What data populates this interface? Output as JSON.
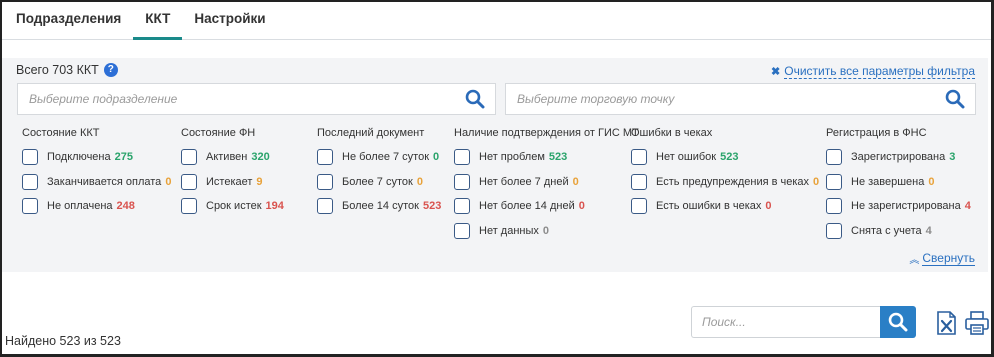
{
  "tabs": [
    {
      "label": "Подразделения",
      "active": false
    },
    {
      "label": "ККТ",
      "active": true
    },
    {
      "label": "Настройки",
      "active": false
    }
  ],
  "filter": {
    "total_label": "Всего 703 ККТ",
    "clear_label": "Очистить все параметры фильтра",
    "division_placeholder": "Выберите подразделение",
    "outlet_placeholder": "Выберите торговую точку",
    "collapse_label": "Свернуть"
  },
  "groups": [
    {
      "title": "Состояние ККТ",
      "options": [
        {
          "label": "Подключена",
          "count": "275",
          "tone": "green"
        },
        {
          "label": "Заканчивается оплата",
          "count": "0",
          "tone": "orange"
        },
        {
          "label": "Не оплачена",
          "count": "248",
          "tone": "red"
        }
      ]
    },
    {
      "title": "Состояние ФН",
      "options": [
        {
          "label": "Активен",
          "count": "320",
          "tone": "green"
        },
        {
          "label": "Истекает",
          "count": "9",
          "tone": "orange"
        },
        {
          "label": "Срок истек",
          "count": "194",
          "tone": "red"
        }
      ]
    },
    {
      "title": "Последний документ",
      "options": [
        {
          "label": "Не более 7 суток",
          "count": "0",
          "tone": "green"
        },
        {
          "label": "Более 7 суток",
          "count": "0",
          "tone": "orange"
        },
        {
          "label": "Более 14 суток",
          "count": "523",
          "tone": "red"
        }
      ]
    },
    {
      "title": "Наличие подтверждения от ГИС МТ",
      "options": [
        {
          "label": "Нет проблем",
          "count": "523",
          "tone": "green"
        },
        {
          "label": "Нет более 7 дней",
          "count": "0",
          "tone": "orange"
        },
        {
          "label": "Нет более 14 дней",
          "count": "0",
          "tone": "red"
        },
        {
          "label": "Нет данных",
          "count": "0",
          "tone": "gray"
        }
      ]
    },
    {
      "title": "Ошибки в чеках",
      "options": [
        {
          "label": "Нет ошибок",
          "count": "523",
          "tone": "green"
        },
        {
          "label": "Есть предупреждения в чеках",
          "count": "0",
          "tone": "orange"
        },
        {
          "label": "Есть ошибки в чеках",
          "count": "0",
          "tone": "red"
        }
      ]
    },
    {
      "title": "Регистрация в ФНС",
      "options": [
        {
          "label": "Зарегистрирована",
          "count": "3",
          "tone": "green"
        },
        {
          "label": "Не завершена",
          "count": "0",
          "tone": "orange"
        },
        {
          "label": "Не зарегистрирована",
          "count": "4",
          "tone": "red"
        },
        {
          "label": "Снята с учета",
          "count": "4",
          "tone": "gray"
        }
      ]
    }
  ],
  "footer": {
    "found_label": "Найдено 523 из 523",
    "search_placeholder": "Поиск..."
  },
  "colors": {
    "accent": "#1a8a8a",
    "link": "#2a70c0",
    "search_button": "#2a7fc6",
    "green": "#2aa36b",
    "orange": "#e8a23a",
    "red": "#d9534f",
    "gray": "#8c8c8c"
  },
  "icons": {
    "help": "question-circle-icon",
    "clear": "close-icon",
    "search": "search-icon",
    "collapse": "chevron-double-up-icon",
    "excel": "excel-export-icon",
    "print": "printer-icon"
  }
}
